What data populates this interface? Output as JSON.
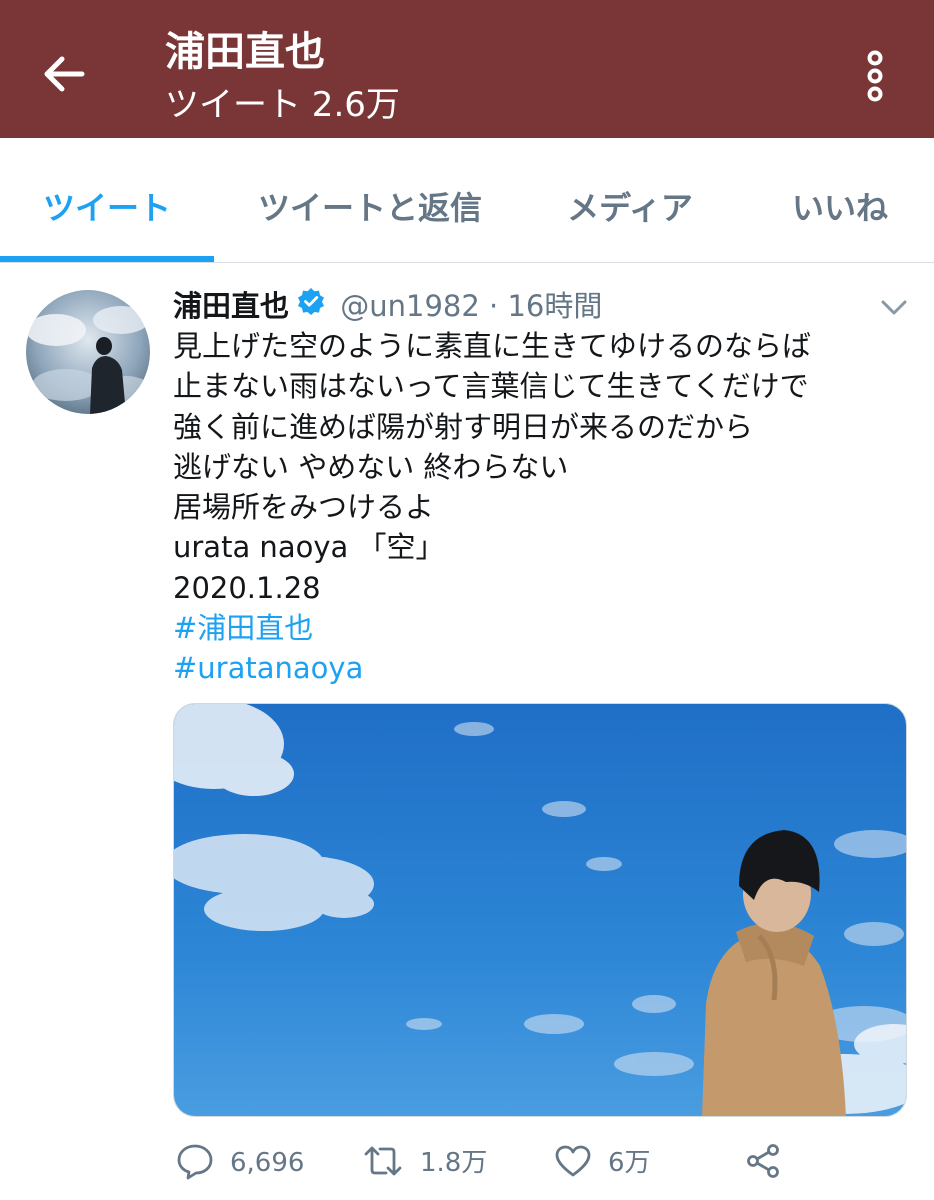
{
  "header": {
    "title": "浦田直也",
    "subtitle": "ツイート 2.6万"
  },
  "tabs": [
    {
      "label": "ツイート",
      "active": true
    },
    {
      "label": "ツイートと返信",
      "active": false
    },
    {
      "label": "メディア",
      "active": false
    },
    {
      "label": "いいね",
      "active": false
    }
  ],
  "tweet": {
    "name": "浦田直也",
    "handle": "@un1982",
    "separator": "·",
    "time": "16時間",
    "lines": [
      "見上げた空のように素直に生きてゆけるのならば",
      "止まない雨はないって言葉信じて生きてくだけで",
      "強く前に進めば陽が射す明日が来るのだから",
      "逃げない やめない 終わらない",
      "居場所をみつけるよ",
      "urata naoya 「空」",
      "2020.1.28"
    ],
    "hashtags": [
      "#浦田直也",
      "#uratanaoya"
    ]
  },
  "actions": {
    "reply_count": "6,696",
    "retweet_count": "1.8万",
    "like_count": "6万"
  },
  "icons": {
    "back": "arrow-left-icon",
    "more": "more-vertical-icon",
    "verified": "verified-badge-icon",
    "caret": "chevron-down-icon",
    "reply": "reply-icon",
    "retweet": "retweet-icon",
    "like": "heart-icon",
    "share": "share-icon"
  },
  "colors": {
    "header_bg": "#7a3636",
    "accent": "#1da1f2",
    "secondary_text": "#657786"
  }
}
